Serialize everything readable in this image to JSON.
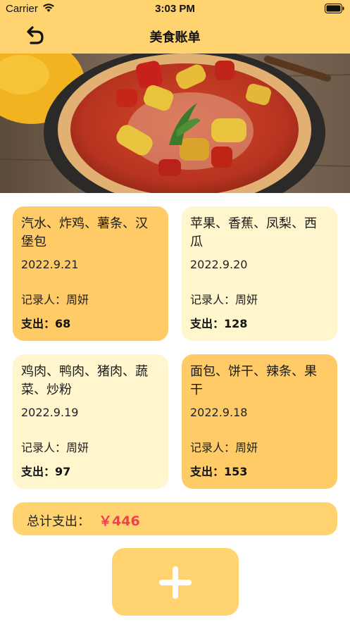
{
  "status_bar": {
    "carrier": "Carrier",
    "time": "3:03 PM",
    "icons": [
      "wifi-icon",
      "battery-icon"
    ]
  },
  "navbar": {
    "title": "美食账单",
    "back_icon": "undo-arrow-icon",
    "bar_color": "#FFD470"
  },
  "hero": {
    "description_icon": "pizza-photo"
  },
  "records": [
    {
      "items": "汽水、炸鸡、薯条、汉堡包",
      "date": "2022.9.21",
      "recorder": "记录人：周妍",
      "expense": "支出：68",
      "style": "dark"
    },
    {
      "items": "苹果、香蕉、凤梨、西瓜",
      "date": "2022.9.20",
      "recorder": "记录人：周妍",
      "expense": "支出：128",
      "style": "light"
    },
    {
      "items": "鸡肉、鸭肉、猪肉、蔬菜、炒粉",
      "date": "2022.9.19",
      "recorder": "记录人：周妍",
      "expense": "支出：97",
      "style": "light"
    },
    {
      "items": "面包、饼干、辣条、果干",
      "date": "2022.9.18",
      "recorder": "记录人：周妍",
      "expense": "支出：153",
      "style": "dark"
    }
  ],
  "total": {
    "label": "总计支出：",
    "value": "￥446",
    "value_color": "#F0414F"
  },
  "add_button": {
    "icon": "plus-icon"
  },
  "colors": {
    "card_dark": "#FFCB67",
    "card_light": "#FFF6CE",
    "accent": "#FFD470"
  }
}
